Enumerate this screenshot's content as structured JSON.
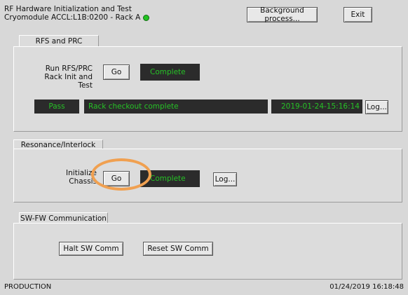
{
  "header": {
    "title_line1": "RF Hardware Initialization and Test",
    "title_line2": "Cryomodule ACCL:L1B:0200 - Rack A",
    "background_button": "Background process...",
    "exit_button": "Exit"
  },
  "rfs_prc": {
    "tab": "RFS and PRC",
    "label_line1": "Run RFS/PRC",
    "label_line2": "Rack Init and Test",
    "go_button": "Go",
    "status": "Complete",
    "result": "Pass",
    "message": "Rack checkout complete",
    "timestamp": "2019-01-24-15:16:14",
    "log_button": "Log..."
  },
  "resonance": {
    "tab": "Resonance/Interlock",
    "label_line1": "Initialize",
    "label_line2": "Chassis",
    "go_button": "Go",
    "status": "Complete",
    "log_button": "Log..."
  },
  "swfw": {
    "tab": "SW-FW Communication",
    "halt_button": "Halt SW Comm",
    "reset_button": "Reset SW Comm"
  },
  "footer": {
    "mode": "PRODUCTION",
    "datetime": "01/24/2019 16:18:48"
  },
  "colors": {
    "status_bg": "#2b2b2b",
    "status_text": "#26c126",
    "led": "#22c322",
    "highlight": "#f0a050"
  }
}
